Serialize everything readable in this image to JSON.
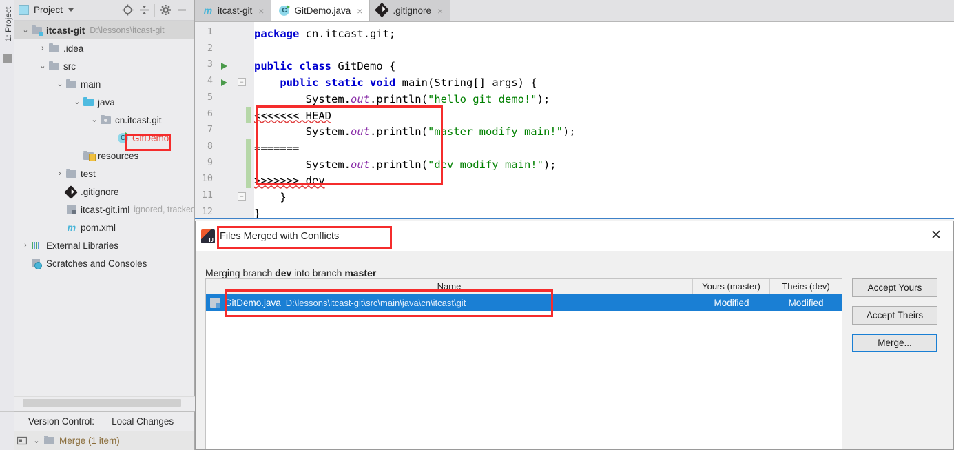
{
  "ide": {
    "tool_window_label": "1: Project",
    "project_panel": {
      "title": "Project",
      "icons": {
        "project_icon": "project-square-icon",
        "dropdown": "chevron-down-icon",
        "locate": "locate-target-icon",
        "collapse_all": "collapse-all-icon",
        "settings": "gear-icon",
        "hide": "minimize-icon"
      },
      "tree": [
        {
          "label": "itcast-git",
          "suffix": "D:\\lessons\\itcast-git",
          "icon": "module-folder-icon",
          "arrow": "⌄",
          "indent": 0,
          "bold": true,
          "selected": true
        },
        {
          "label": ".idea",
          "suffix": "",
          "icon": "folder-icon",
          "arrow": "›",
          "indent": 1,
          "bold": false,
          "selected": false
        },
        {
          "label": "src",
          "suffix": "",
          "icon": "folder-icon",
          "arrow": "⌄",
          "indent": 1,
          "bold": false,
          "selected": false
        },
        {
          "label": "main",
          "suffix": "",
          "icon": "folder-icon",
          "arrow": "⌄",
          "indent": 2,
          "bold": false,
          "selected": false
        },
        {
          "label": "java",
          "suffix": "",
          "icon": "source-folder-icon",
          "arrow": "⌄",
          "indent": 3,
          "bold": false,
          "selected": false
        },
        {
          "label": "cn.itcast.git",
          "suffix": "",
          "icon": "package-folder-icon",
          "arrow": "⌄",
          "indent": 4,
          "bold": false,
          "selected": false
        },
        {
          "label": "GitDemo",
          "suffix": "",
          "icon": "java-class-icon",
          "arrow": "",
          "indent": 5,
          "bold": false,
          "selected": false,
          "color": "red"
        },
        {
          "label": "resources",
          "suffix": "",
          "icon": "resources-folder-icon",
          "arrow": "",
          "indent": 3,
          "bold": false,
          "selected": false
        },
        {
          "label": "test",
          "suffix": "",
          "icon": "folder-icon",
          "arrow": "›",
          "indent": 2,
          "bold": false,
          "selected": false
        },
        {
          "label": ".gitignore",
          "suffix": "",
          "icon": "git-file-icon",
          "arrow": "",
          "indent": 2,
          "bold": false,
          "selected": false
        },
        {
          "label": "itcast-git.iml",
          "suffix": "ignored, tracked w",
          "icon": "iml-file-icon",
          "arrow": "",
          "indent": 2,
          "bold": false,
          "selected": false
        },
        {
          "label": "pom.xml",
          "suffix": "",
          "icon": "maven-file-icon",
          "arrow": "",
          "indent": 2,
          "bold": false,
          "selected": false
        },
        {
          "label": "External Libraries",
          "suffix": "",
          "icon": "libraries-icon",
          "arrow": "›",
          "indent": 0,
          "bold": false,
          "selected": false
        },
        {
          "label": "Scratches and Consoles",
          "suffix": "",
          "icon": "scratches-icon",
          "arrow": "",
          "indent": 0,
          "bold": false,
          "selected": false
        }
      ]
    },
    "editor_tabs": [
      {
        "label": "itcast-git",
        "icon": "maven-file-icon",
        "active": false,
        "close": "×"
      },
      {
        "label": "GitDemo.java",
        "icon": "java-class-icon",
        "active": true,
        "close": "×"
      },
      {
        "label": ".gitignore",
        "icon": "git-file-icon",
        "active": false,
        "close": "×"
      }
    ],
    "editor": {
      "line_numbers": [
        "1",
        "2",
        "3",
        "4",
        "5",
        "6",
        "7",
        "8",
        "9",
        "10",
        "11",
        "12"
      ],
      "lines": [
        "package cn.itcast.git;",
        "",
        "public class GitDemo {",
        "    public static void main(String[] args) {",
        "        System.out.println(\"hello git demo!\");",
        "<<<<<<< HEAD",
        "        System.out.println(\"master modify main!\");",
        "=======",
        "        System.out.println(\"dev modify main!\");",
        ">>>>>>> dev",
        "    }",
        "}"
      ],
      "conflict_markers": {
        "ours_start": "<<<<<<< HEAD",
        "separator": "=======",
        "theirs_end": ">>>>>>> dev"
      }
    },
    "version_control": {
      "label": "Version Control:",
      "tab": "Local Changes",
      "changelist": "Merge (1 item)",
      "changelist_arrow": "⌄"
    }
  },
  "dialog": {
    "title": "Files Merged with Conflicts",
    "icon": "intellij-idea-icon",
    "close_label": "✕",
    "subtitle_prefix": "Merging branch ",
    "subtitle_branch_source": "dev",
    "subtitle_middle": " into branch ",
    "subtitle_branch_target": "master",
    "table": {
      "columns": [
        "Name",
        "Yours (master)",
        "Theirs (dev)"
      ],
      "rows": [
        {
          "file_icon": "java-file-icon",
          "name": "GitDemo.java",
          "path": "D:\\lessons\\itcast-git\\src\\main\\java\\cn\\itcast\\git",
          "yours": "Modified",
          "theirs": "Modified",
          "selected": true
        }
      ]
    },
    "buttons": [
      {
        "label": "Accept Yours",
        "focused": false
      },
      {
        "label": "Accept Theirs",
        "focused": false
      },
      {
        "label": "Merge...",
        "focused": true
      }
    ]
  },
  "annotations": {
    "accent_red": "#f52c2c",
    "selection_blue": "#1a7fd4",
    "boxes": [
      "gitdemo-tree-node",
      "conflict-block",
      "dialog-title",
      "conflicted-file-row"
    ]
  }
}
